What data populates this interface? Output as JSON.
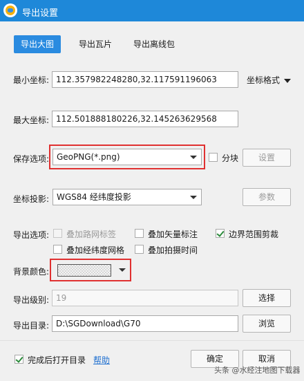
{
  "window": {
    "title": "导出设置",
    "icon": "globe-icon",
    "title_bar_color": "#1e88d9"
  },
  "tabs": [
    {
      "label": "导出大图",
      "active": true
    },
    {
      "label": "导出瓦片",
      "active": false
    },
    {
      "label": "导出离线包",
      "active": false
    }
  ],
  "min_coord": {
    "label": "最小坐标:",
    "value": "112.357982248280,32.117591196063"
  },
  "coord_format": {
    "label": "坐标格式"
  },
  "max_coord": {
    "label": "最大坐标:",
    "value": "112.501888180226,32.145263629568"
  },
  "save_option": {
    "label": "保存选项:",
    "value": "GeoPNG(*.png)"
  },
  "tile_split": {
    "label": "分块",
    "checked": false
  },
  "settings_button": {
    "label": "设置"
  },
  "projection": {
    "label": "坐标投影:",
    "value": "WGS84 经纬度投影"
  },
  "params_button": {
    "label": "参数"
  },
  "export_options": {
    "label": "导出选项:",
    "items": [
      {
        "label": "叠加路网标签",
        "checked": false,
        "disabled": true
      },
      {
        "label": "叠加矢量标注",
        "checked": false,
        "disabled": false
      },
      {
        "label": "边界范围剪裁",
        "checked": true,
        "disabled": false
      },
      {
        "label": "叠加经纬度网格",
        "checked": false,
        "disabled": false
      },
      {
        "label": "叠加拍摄时间",
        "checked": false,
        "disabled": false
      }
    ]
  },
  "bg_color": {
    "label": "背景颜色:"
  },
  "export_level": {
    "label": "导出级别:",
    "value": "19"
  },
  "select_button": {
    "label": "选择"
  },
  "export_dir": {
    "label": "导出目录:",
    "value": "D:\\SGDownload\\G70"
  },
  "browse_button": {
    "label": "浏览"
  },
  "open_after": {
    "label": "完成后打开目录",
    "checked": true
  },
  "help_link": {
    "label": "帮助"
  },
  "ok_button": {
    "label": "确定"
  },
  "cancel_button": {
    "label": "取消"
  },
  "watermark": {
    "text": "头条 @水经注地图下载器"
  },
  "highlight_color": "#e03030",
  "accent_color": "#2a8be0"
}
